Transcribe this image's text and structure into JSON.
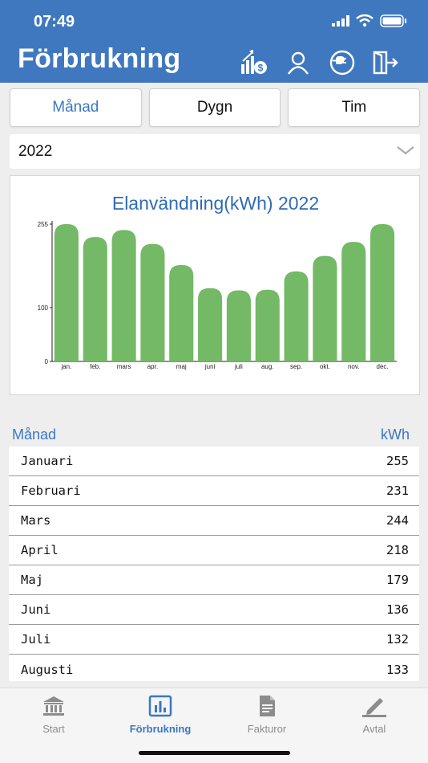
{
  "status": {
    "time": "07:49"
  },
  "header": {
    "title": "Förbrukning"
  },
  "tabs": [
    {
      "label": "Månad",
      "active": true
    },
    {
      "label": "Dygn",
      "active": false
    },
    {
      "label": "Tim",
      "active": false
    }
  ],
  "year_select": {
    "value": "2022"
  },
  "chart_data": {
    "type": "bar",
    "title": "Elanvändning(kWh) 2022",
    "categories": [
      "jan.",
      "feb.",
      "mars",
      "apr.",
      "maj",
      "juni",
      "juli",
      "aug.",
      "sep.",
      "okt.",
      "nov.",
      "dec."
    ],
    "values": [
      255,
      231,
      244,
      218,
      179,
      136,
      132,
      133,
      167,
      196,
      222,
      255
    ],
    "yticks": [
      0,
      100,
      255
    ],
    "ylim": [
      0,
      255
    ],
    "bar_color": "#73b966"
  },
  "list": {
    "header_month": "Månad",
    "header_unit": "kWh",
    "rows": [
      {
        "month": "Januari",
        "kwh": "255"
      },
      {
        "month": "Februari",
        "kwh": "231"
      },
      {
        "month": "Mars",
        "kwh": "244"
      },
      {
        "month": "April",
        "kwh": "218"
      },
      {
        "month": "Maj",
        "kwh": "179"
      },
      {
        "month": "Juni",
        "kwh": "136"
      },
      {
        "month": "Juli",
        "kwh": "132"
      },
      {
        "month": "Augusti",
        "kwh": "133"
      }
    ]
  },
  "tabbar": [
    {
      "label": "Start",
      "icon": "bank-icon",
      "active": false
    },
    {
      "label": "Förbrukning",
      "icon": "chart-icon",
      "active": true
    },
    {
      "label": "Fakturor",
      "icon": "document-icon",
      "active": false
    },
    {
      "label": "Avtal",
      "icon": "pen-icon",
      "active": false
    }
  ],
  "colors": {
    "header": "#3f78bf",
    "accent": "#3a78c3",
    "bar": "#73b966"
  }
}
